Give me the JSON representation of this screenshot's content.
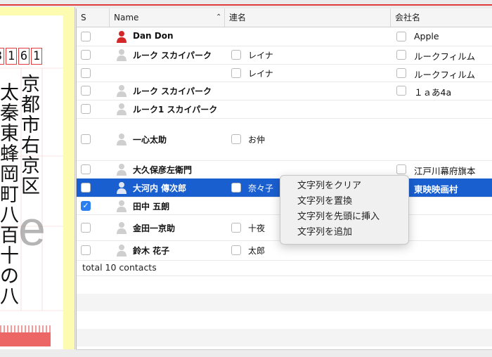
{
  "postcard": {
    "zip_digits": [
      "3",
      "1",
      "6",
      "1"
    ],
    "address_col1": "京都市右京区",
    "address_col2": "太秦東蜂岡町八百十の八",
    "watermark": "e"
  },
  "table": {
    "headers": {
      "s": "S",
      "name": "Name",
      "ren": "連名",
      "company": "会社名"
    },
    "rows": [
      {
        "name": "Dan Don",
        "ren": "",
        "company": "Apple",
        "avatar": "red",
        "ren_cb": false,
        "co_cb": true,
        "checked": false
      },
      {
        "name": "ルーク スカイパーク",
        "ren": "レイナ",
        "company": "ルークフィルム",
        "avatar": "gray",
        "ren_cb": true,
        "co_cb": true,
        "checked": false
      },
      {
        "name": "",
        "ren": "レイナ",
        "company": "ルークフィルム",
        "avatar": "none",
        "ren_cb": true,
        "co_cb": true,
        "checked": false
      },
      {
        "name": "ルーク スカイパーク",
        "ren": "",
        "company": "１ａあ4a",
        "avatar": "gray",
        "ren_cb": false,
        "co_cb": true,
        "checked": false
      },
      {
        "name": "ルーク1 スカイパーク",
        "ren": "",
        "company": "",
        "avatar": "gray",
        "ren_cb": false,
        "co_cb": false,
        "checked": false
      },
      {
        "name": "一心太助",
        "ren": "お仲",
        "company": "",
        "avatar": "gray",
        "ren_cb": true,
        "co_cb": false,
        "checked": false
      },
      {
        "name": "大久保彦左衛門",
        "ren": "",
        "company": "江戸川幕府旗本",
        "avatar": "gray",
        "ren_cb": false,
        "co_cb": true,
        "checked": false
      },
      {
        "name": "大河内 傳次郎",
        "ren": "奈々子",
        "company": "東映映画村",
        "avatar": "gray",
        "ren_cb": true,
        "co_cb": true,
        "checked": false,
        "selected": true
      },
      {
        "name": "田中 五朗",
        "ren": "",
        "company": "",
        "avatar": "gray",
        "ren_cb": false,
        "co_cb": false,
        "checked": true
      },
      {
        "name": "金田一京助",
        "ren": "十夜",
        "company": "",
        "avatar": "gray",
        "ren_cb": true,
        "co_cb": false,
        "checked": false
      },
      {
        "name": "鈴木 花子",
        "ren": "太郎",
        "company": "",
        "avatar": "gray",
        "ren_cb": true,
        "co_cb": false,
        "checked": false
      }
    ],
    "footer": "total 10 contacts"
  },
  "context_menu": {
    "items": [
      "文字列をクリア",
      "文字列を置換",
      "文字列を先頭に挿入",
      "文字列を追加"
    ]
  },
  "colors": {
    "selection": "#1a5fd0",
    "accent_red": "#e23b3b",
    "postcard_bg": "#fdfbb0"
  }
}
